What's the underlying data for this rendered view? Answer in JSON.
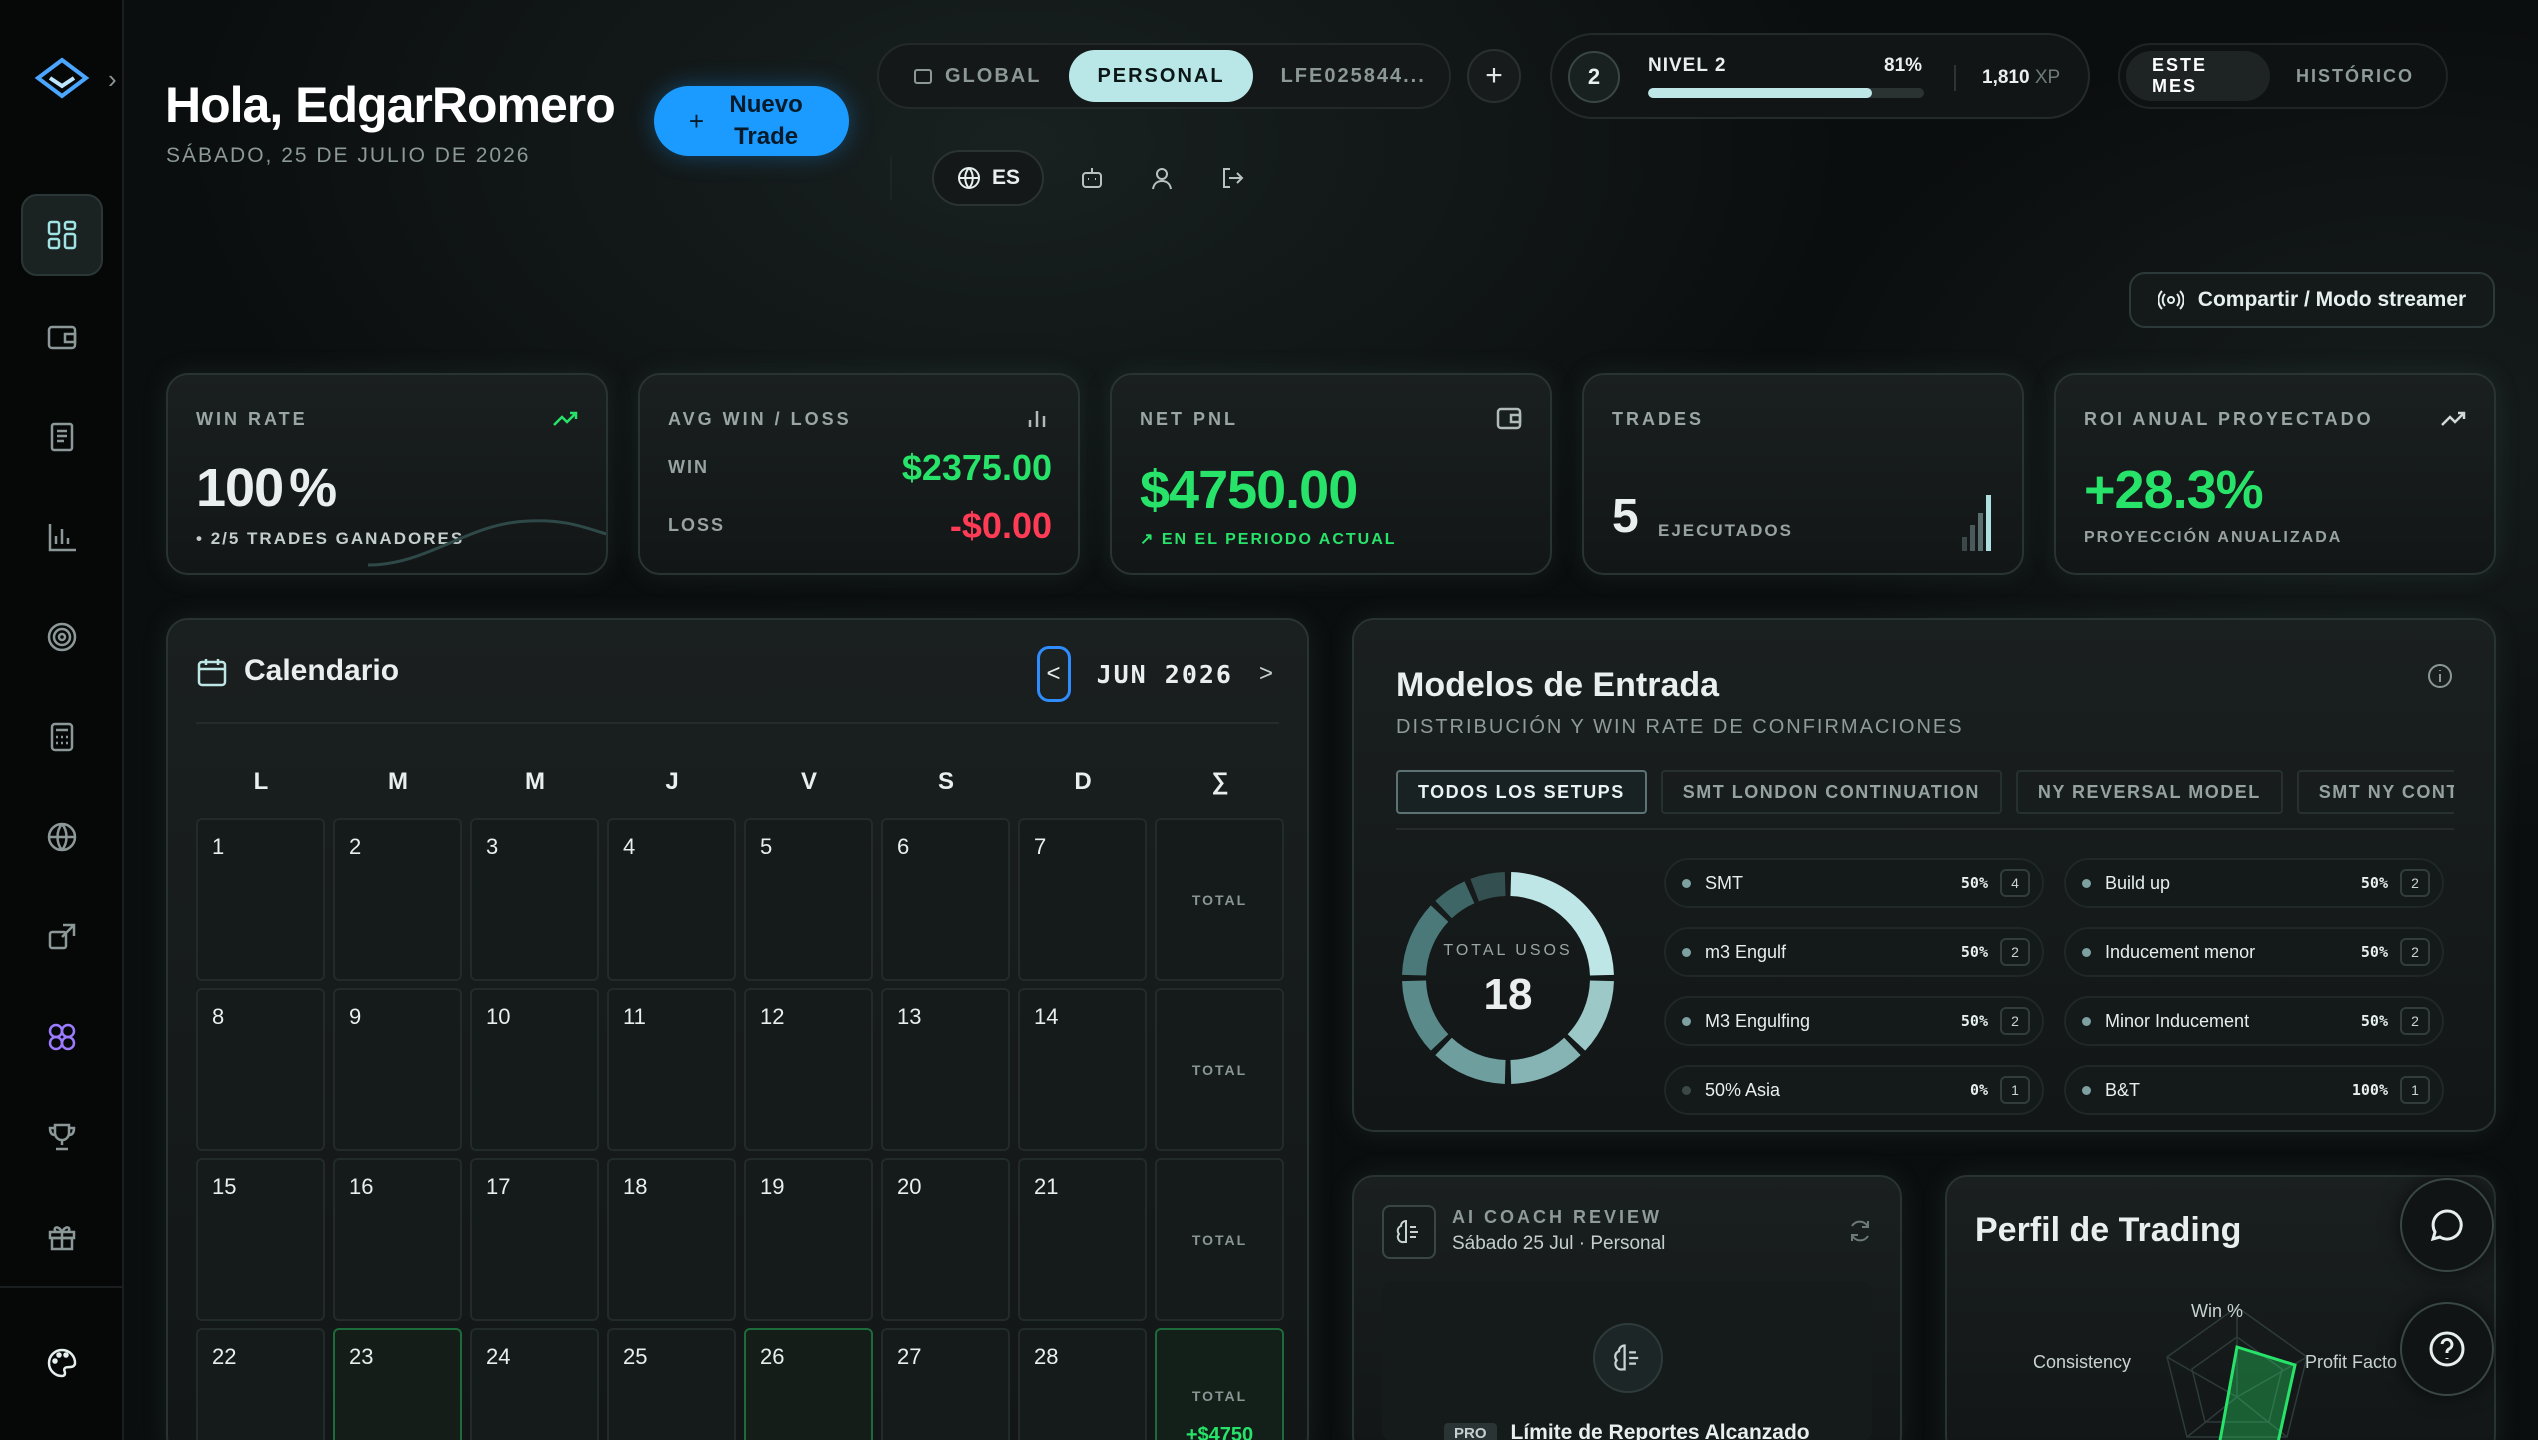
{
  "header": {
    "greeting": "Hola, EdgarRomero",
    "date": "SÁBADO, 25 DE JULIO DE 2026",
    "new_trade_label": "Nuevo Trade",
    "scope_tabs": [
      {
        "label": "GLOBAL",
        "active": false
      },
      {
        "label": "PERSONAL",
        "active": true
      },
      {
        "label": "LFE025844...",
        "active": false
      }
    ],
    "language": "ES",
    "share_label": "Compartir / Modo streamer"
  },
  "level": {
    "number": "2",
    "label": "NIVEL 2",
    "percent_label": "81%",
    "progress": 0.81,
    "xp_value": "1,810",
    "xp_unit": "XP"
  },
  "period_tabs": [
    {
      "label": "ESTE MES",
      "active": true
    },
    {
      "label": "HISTÓRICO",
      "active": false
    }
  ],
  "kpis": {
    "win_rate": {
      "label": "WIN RATE",
      "value": "100",
      "unit": "%",
      "sub": "2/5 TRADES GANADORES"
    },
    "avg": {
      "label": "AVG WIN / LOSS",
      "win_label": "WIN",
      "win_value": "$2375.00",
      "loss_label": "LOSS",
      "loss_value": "-$0.00"
    },
    "net": {
      "label": "NET PNL",
      "value": "$4750.00",
      "sub": "EN EL PERIODO ACTUAL"
    },
    "trades": {
      "label": "TRADES",
      "value": "5",
      "sub": "EJECUTADOS"
    },
    "roi": {
      "label": "ROI ANUAL PROYECTADO",
      "value": "+28.3%",
      "sub": "PROYECCIÓN ANUALIZADA"
    }
  },
  "calendar": {
    "title": "Calendario",
    "month": "JUN 2026",
    "prev": "<",
    "next": ">",
    "weekdays": [
      "L",
      "M",
      "M",
      "J",
      "V",
      "S",
      "D",
      "∑"
    ],
    "weeks": [
      {
        "days": [
          "1",
          "2",
          "3",
          "4",
          "5",
          "6",
          "7"
        ],
        "total_label": "TOTAL",
        "total_value": ""
      },
      {
        "days": [
          "8",
          "9",
          "10",
          "11",
          "12",
          "13",
          "14"
        ],
        "total_label": "TOTAL",
        "total_value": ""
      },
      {
        "days": [
          "15",
          "16",
          "17",
          "18",
          "19",
          "20",
          "21"
        ],
        "total_label": "TOTAL",
        "total_value": ""
      },
      {
        "days": [
          "22",
          "23",
          "24",
          "25",
          "26",
          "27",
          "28"
        ],
        "total_label": "TOTAL",
        "total_value": "+$4750"
      }
    ]
  },
  "models": {
    "title": "Modelos de Entrada",
    "subtitle": "DISTRIBUCIÓN Y WIN RATE DE CONFIRMACIONES",
    "tabs": [
      "TODOS LOS SETUPS",
      "SMT LONDON CONTINUATION",
      "NY REVERSAL MODEL",
      "SMT NY CONTINUATI"
    ],
    "total_label": "TOTAL USOS",
    "total_value": "18",
    "setups": [
      {
        "name": "SMT",
        "pct": "50%",
        "count": "4"
      },
      {
        "name": "Build up",
        "pct": "50%",
        "count": "2"
      },
      {
        "name": "m3 Engulf",
        "pct": "50%",
        "count": "2"
      },
      {
        "name": "Inducement menor",
        "pct": "50%",
        "count": "2"
      },
      {
        "name": "M3 Engulfing",
        "pct": "50%",
        "count": "2"
      },
      {
        "name": "Minor Inducement",
        "pct": "50%",
        "count": "2"
      },
      {
        "name": "50% Asia",
        "pct": "0%",
        "count": "1"
      },
      {
        "name": "B&T",
        "pct": "100%",
        "count": "1"
      }
    ]
  },
  "ai_coach": {
    "label": "AI COACH REVIEW",
    "date": "Sábado 25 Jul · Personal",
    "badge": "PRO",
    "limit_text": "Límite de Reportes Alcanzado"
  },
  "profile": {
    "title": "Perfil de Trading",
    "axes": [
      "Win %",
      "Consistency",
      "Profit Facto"
    ]
  },
  "colors": {
    "accent": "#1b9bff",
    "positive": "#28e36a",
    "negative": "#ff3b55",
    "active_tab": "#b9e6e6"
  }
}
